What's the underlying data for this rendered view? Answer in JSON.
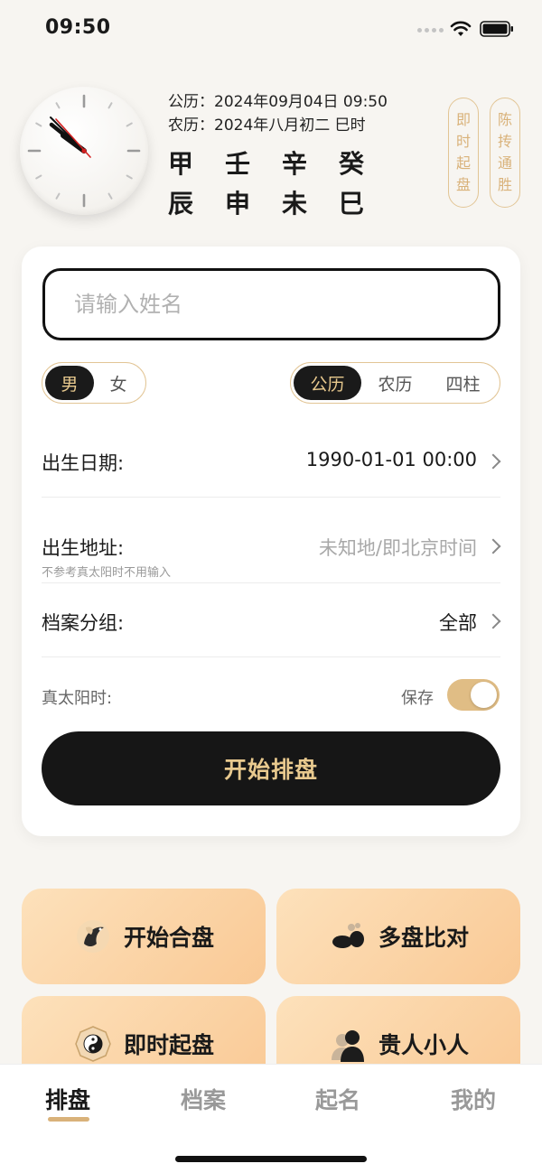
{
  "status_bar": {
    "time": "09:50"
  },
  "header": {
    "gregorian_label": "公历：",
    "gregorian_value": "2024年09月04日 09:50",
    "lunar_label": "农历：",
    "lunar_value": "2024年八月初二 巳时",
    "stems": [
      "甲",
      "壬",
      "辛",
      "癸"
    ],
    "branches": [
      "辰",
      "申",
      "未",
      "巳"
    ],
    "pill_instant": [
      "即",
      "时",
      "起",
      "盘"
    ],
    "pill_chen": [
      "陈",
      "抟",
      "通",
      "胜"
    ]
  },
  "form": {
    "name_placeholder": "请输入姓名",
    "gender_options": [
      "男",
      "女"
    ],
    "gender_selected": "男",
    "calendar_options": [
      "公历",
      "农历",
      "四柱"
    ],
    "calendar_selected": "公历",
    "birth_date_label": "出生日期:",
    "birth_date_value": "1990-01-01 00:00",
    "birth_place_label": "出生地址:",
    "birth_place_value": "未知地/即北京时间",
    "birth_place_note": "不参考真太阳时不用输入",
    "group_label": "档案分组:",
    "group_value": "全部",
    "solar_label": "真太阳时:",
    "save_label": "保存",
    "save_enabled": true,
    "start_button": "开始排盘"
  },
  "features": [
    {
      "label": "开始合盘",
      "icon": "koi-fish-icon"
    },
    {
      "label": "多盘比对",
      "icon": "ink-blot-icon"
    },
    {
      "label": "即时起盘",
      "icon": "yin-yang-icon"
    },
    {
      "label": "贵人小人",
      "icon": "people-silhouette-icon"
    }
  ],
  "tabs": [
    "排盘",
    "档案",
    "起名",
    "我的"
  ],
  "tab_active": "排盘",
  "colors": {
    "accent_gold": "#d9b27a",
    "button_dark": "#161616",
    "tile_gradient_start": "#fde1bb",
    "tile_gradient_end": "#f9c995"
  }
}
